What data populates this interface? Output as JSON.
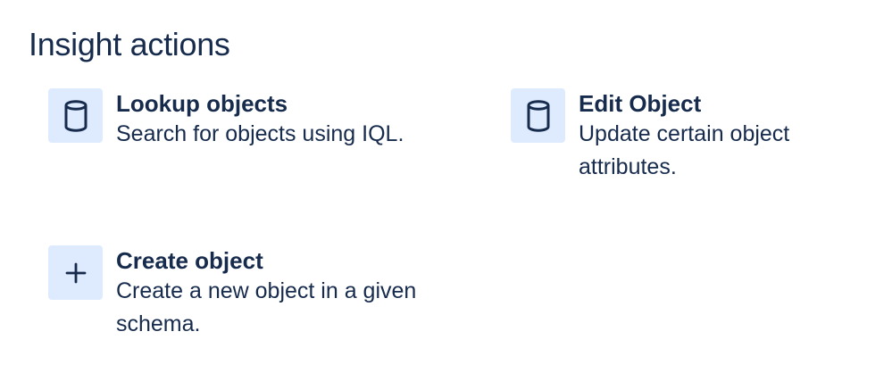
{
  "page": {
    "title": "Insight actions"
  },
  "actions": [
    {
      "title": "Lookup objects",
      "description": "Search for objects using IQL.",
      "icon": "database-icon"
    },
    {
      "title": "Edit Object",
      "description": "Update certain object attributes.",
      "icon": "database-icon"
    },
    {
      "title": "Create object",
      "description": "Create a new object in a given schema.",
      "icon": "plus-icon"
    }
  ],
  "colors": {
    "text": "#172b4d",
    "icon_background": "#deebff"
  }
}
